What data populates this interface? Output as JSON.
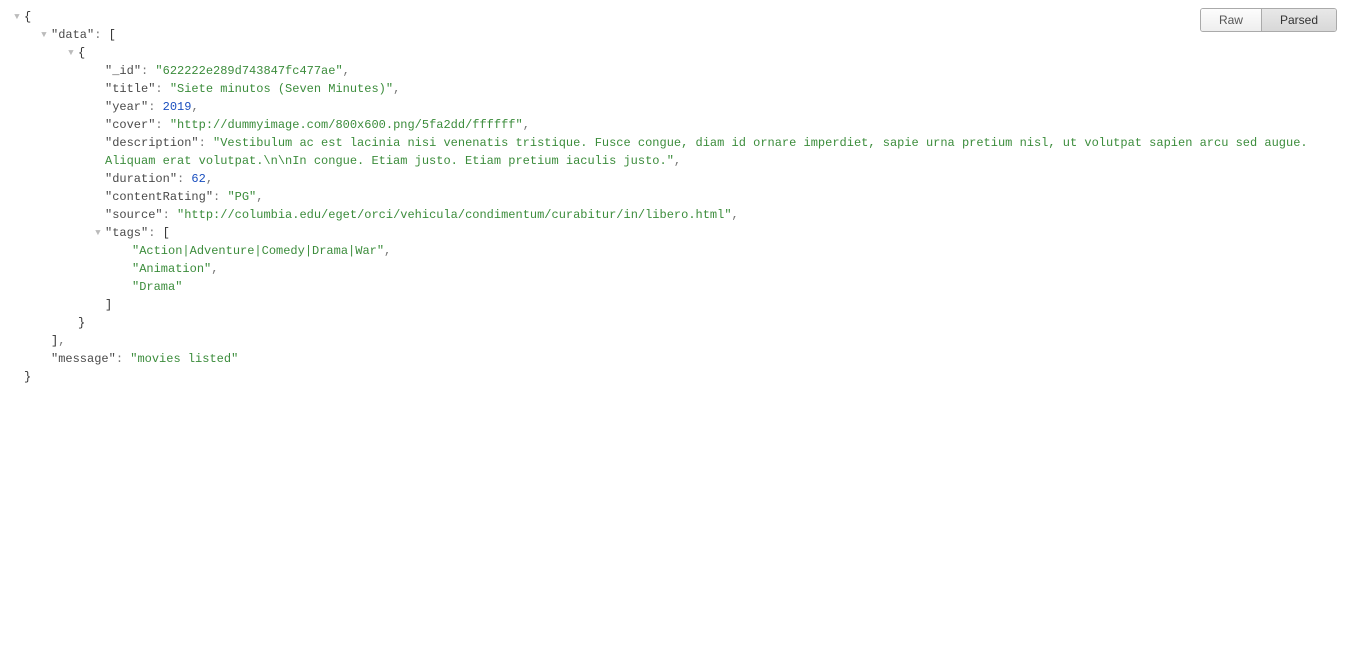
{
  "toolbar": {
    "raw_label": "Raw",
    "parsed_label": "Parsed"
  },
  "indent_unit": 27,
  "toggle_glyph": "▼",
  "json_content": {
    "data_key": "data",
    "message_key": "message",
    "message_value": "movies listed",
    "record": {
      "fields": {
        "_id": {
          "key": "_id",
          "value": "622222e289d743847fc477ae",
          "type": "string"
        },
        "title": {
          "key": "title",
          "value": "Siete minutos (Seven Minutes)",
          "type": "string"
        },
        "year": {
          "key": "year",
          "value": "2019",
          "type": "number"
        },
        "cover": {
          "key": "cover",
          "value": "http://dummyimage.com/800x600.png/5fa2dd/ffffff",
          "type": "string"
        },
        "description": {
          "key": "description",
          "value": "Vestibulum ac est lacinia nisi venenatis tristique. Fusce congue, diam id ornare imperdiet, sapie urna pretium nisl, ut volutpat sapien arcu sed augue. Aliquam erat volutpat.\\n\\nIn congue. Etiam justo. Etiam pretium iaculis justo.",
          "type": "string"
        },
        "duration": {
          "key": "duration",
          "value": "62",
          "type": "number"
        },
        "contentRating": {
          "key": "contentRating",
          "value": "PG",
          "type": "string"
        },
        "source": {
          "key": "source",
          "value": "http://columbia.edu/eget/orci/vehicula/condimentum/curabitur/in/libero.html",
          "type": "string"
        },
        "tags_key": "tags",
        "tags": [
          "Action|Adventure|Comedy|Drama|War",
          "Animation",
          "Drama"
        ]
      }
    }
  }
}
